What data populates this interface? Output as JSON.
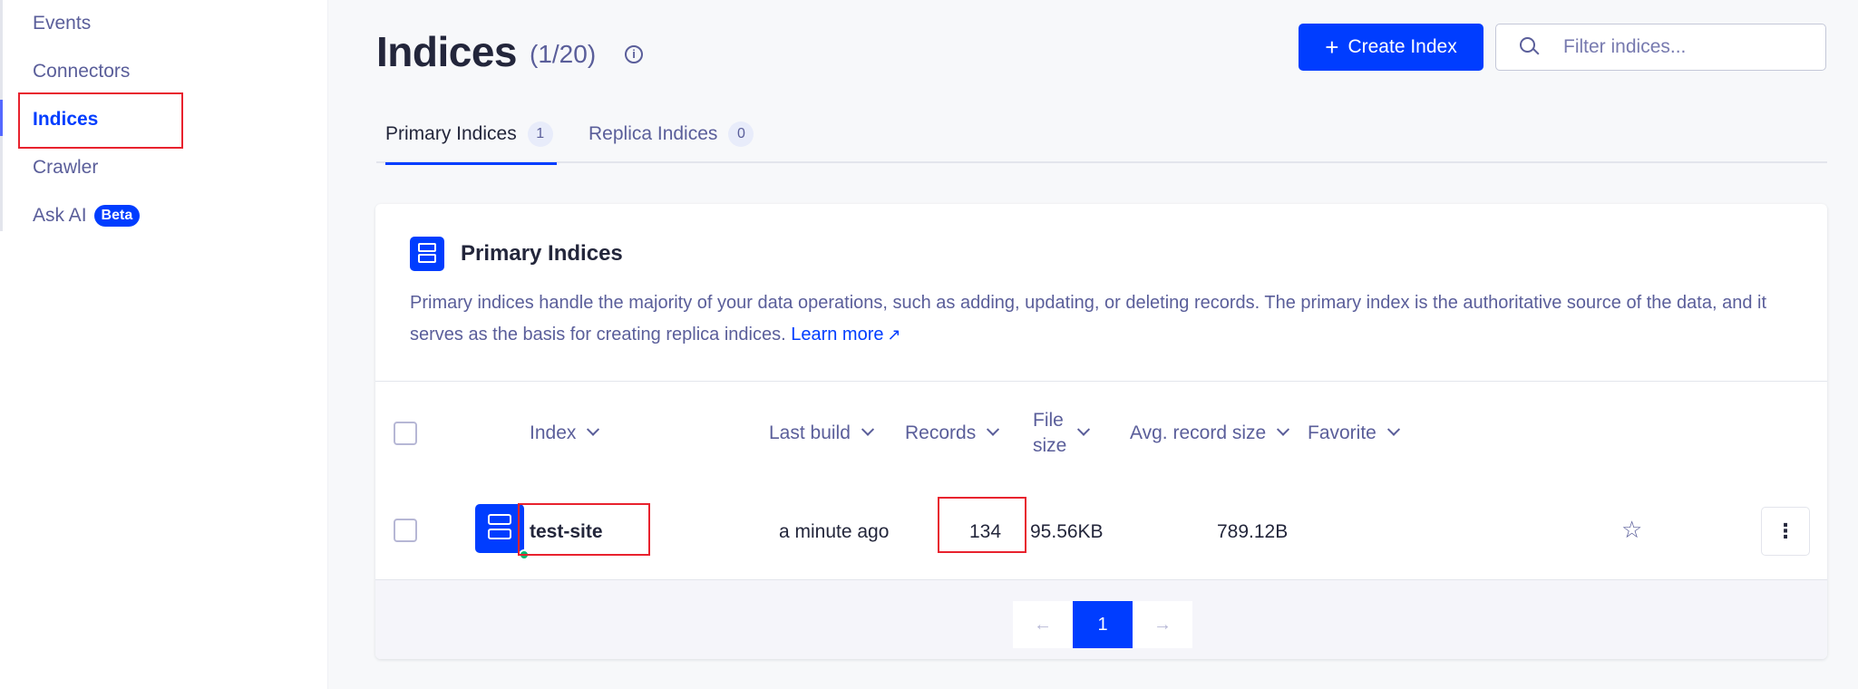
{
  "sidebar": {
    "items": [
      {
        "label": "Events"
      },
      {
        "label": "Connectors"
      },
      {
        "label": "Indices"
      },
      {
        "label": "Crawler"
      },
      {
        "label": "Ask AI",
        "badge": "Beta"
      }
    ],
    "active_item": "Indices"
  },
  "header": {
    "title": "Indices",
    "count": "(1/20)",
    "create_label": "Create Index",
    "search_placeholder": "Filter indices..."
  },
  "tabs": [
    {
      "label": "Primary Indices",
      "count": "1"
    },
    {
      "label": "Replica Indices",
      "count": "0"
    }
  ],
  "card": {
    "title": "Primary Indices",
    "description": "Primary indices handle the majority of your data operations, such as adding, updating, or deleting records. The primary index is the authoritative source of the data, and it serves as the basis for creating replica indices.",
    "learn_more": "Learn more"
  },
  "table": {
    "columns": {
      "index": "Index",
      "last_build": "Last build",
      "records": "Records",
      "file_size_line1": "File",
      "file_size_line2": "size",
      "avg_record_size": "Avg. record size",
      "favorite": "Favorite"
    },
    "rows": [
      {
        "name": "test-site",
        "last_build": "a minute ago",
        "records": "134",
        "file_size": "95.56KB",
        "avg_record_size": "789.12B",
        "favorite": false,
        "status": "ok"
      }
    ]
  },
  "pagination": {
    "prev": "←",
    "current": "1",
    "next": "→"
  },
  "colors": {
    "accent": "#003dff",
    "highlight_box": "#e8222e",
    "status_ok": "#06b66c"
  }
}
